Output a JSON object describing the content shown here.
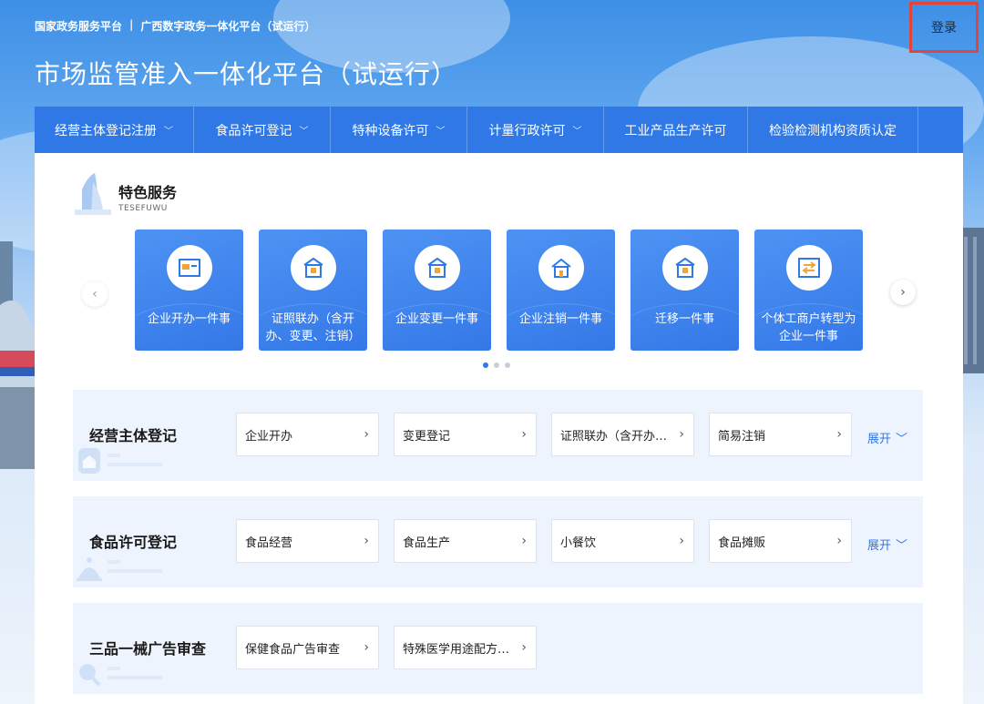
{
  "header": {
    "links": [
      "国家政务服务平台",
      "广西数字政务一体化平台（试运行）"
    ],
    "separator": "|",
    "login": "登录",
    "title": "市场监管准入一体化平台（试运行）"
  },
  "nav": {
    "items": [
      {
        "label": "经营主体登记注册",
        "dropdown": true
      },
      {
        "label": "食品许可登记",
        "dropdown": true
      },
      {
        "label": "特种设备许可",
        "dropdown": true
      },
      {
        "label": "计量行政许可",
        "dropdown": true
      },
      {
        "label": "工业产品生产许可",
        "dropdown": false
      },
      {
        "label": "检验检测机构资质认定",
        "dropdown": false
      }
    ]
  },
  "featured": {
    "title": "特色服务",
    "subtitle": "TESEFUWU",
    "cards": [
      {
        "label": "企业开办一件事",
        "icon": "register-icon"
      },
      {
        "label": "证照联办（含开办、变更、注销）",
        "icon": "building-icon"
      },
      {
        "label": "企业变更一件事",
        "icon": "building-icon"
      },
      {
        "label": "企业注销一件事",
        "icon": "house-icon"
      },
      {
        "label": "迁移一件事",
        "icon": "building-icon"
      },
      {
        "label": "个体工商户转型为企业一件事",
        "icon": "transfer-icon"
      }
    ],
    "pages": 3,
    "active_page": 1
  },
  "categories": [
    {
      "title": "经营主体登记",
      "items": [
        "企业开办",
        "变更登记",
        "证照联办（含开办、变更、注销）",
        "简易注销"
      ],
      "expand": "展开"
    },
    {
      "title": "食品许可登记",
      "items": [
        "食品经营",
        "食品生产",
        "小餐饮",
        "食品摊贩"
      ],
      "expand": "展开"
    },
    {
      "title": "三品一械广告审查",
      "items": [
        "保健食品广告审查",
        "特殊医学用途配方食品广告审查"
      ],
      "expand": ""
    }
  ],
  "colors": {
    "primary": "#2f78e6",
    "login_highlight": "#e0453c"
  }
}
